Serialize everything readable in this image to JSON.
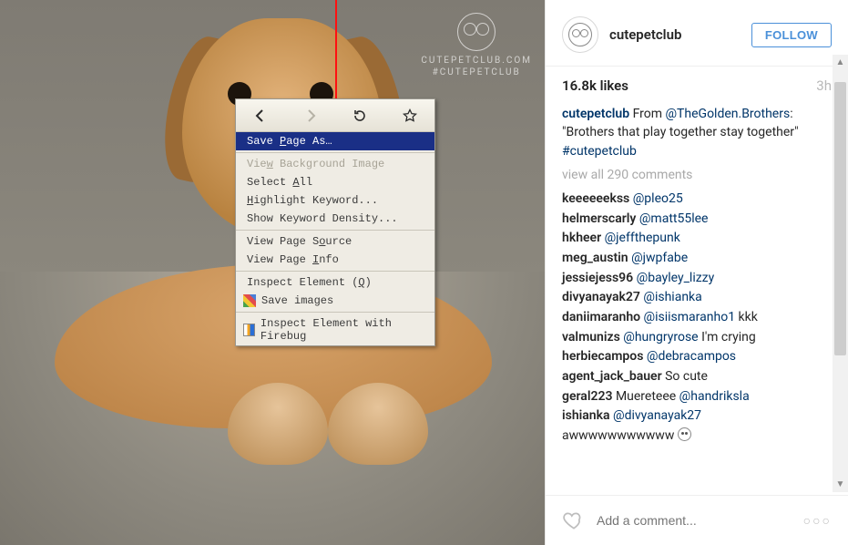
{
  "watermark": {
    "line1": "CUTEPETCLUB.COM",
    "line2": "#CUTEPETCLUB"
  },
  "context_menu": {
    "toolbar": {
      "back": "back-icon",
      "forward": "forward-icon",
      "reload": "reload-icon",
      "bookmark": "star-icon"
    },
    "items": [
      {
        "kind": "item",
        "label": "Save Page As…",
        "underline": "P",
        "selected": true
      },
      {
        "kind": "sep"
      },
      {
        "kind": "item",
        "label": "View Background Image",
        "underline": "w",
        "disabled": true
      },
      {
        "kind": "item",
        "label": "Select All",
        "underline": "A"
      },
      {
        "kind": "item",
        "label": "Highlight Keyword...",
        "underline": "H"
      },
      {
        "kind": "item",
        "label": "Show Keyword Density..."
      },
      {
        "kind": "sep"
      },
      {
        "kind": "item",
        "label": "View Page Source",
        "underline": "o"
      },
      {
        "kind": "item",
        "label": "View Page Info",
        "underline": "I"
      },
      {
        "kind": "sep"
      },
      {
        "kind": "item",
        "label": "Inspect Element (Q)",
        "underline": "Q"
      },
      {
        "kind": "item-icon",
        "icon": "sv",
        "label": "Save images"
      },
      {
        "kind": "sep"
      },
      {
        "kind": "item-icon",
        "icon": "fb",
        "label": "Inspect Element with Firebug"
      }
    ]
  },
  "post": {
    "username": "cutepetclub",
    "follow_label": "FOLLOW",
    "likes": "16.8k likes",
    "age": "3h",
    "caption_user": "cutepetclub",
    "caption_before": " From ",
    "caption_mention": "@TheGolden.Brothers",
    "caption_after": ": \"Brothers that play together stay together\" ",
    "caption_hashtag": "#cutepetclub",
    "view_all": "view all 290 comments",
    "add_comment_placeholder": "Add a comment...",
    "more": "○ ○ ○"
  },
  "comments": [
    {
      "user": "keeeeeekss",
      "tag": "@pleo25",
      "text": ""
    },
    {
      "user": "helmerscarly",
      "tag": "@matt55lee",
      "text": ""
    },
    {
      "user": "hkheer",
      "tag": "@jeffthepunk",
      "text": ""
    },
    {
      "user": "meg_austin",
      "tag": "@jwpfabe",
      "text": ""
    },
    {
      "user": "jessiejess96",
      "tag": "@bayley_lizzy",
      "text": ""
    },
    {
      "user": "divyanayak27",
      "tag": "@ishianka",
      "text": ""
    },
    {
      "user": "daniimaranho",
      "tag": "@isiismaranho1",
      "text": " kkk"
    },
    {
      "user": "valmunizs",
      "tag": "@hungryrose",
      "text": " I'm crying"
    },
    {
      "user": "herbiecampos",
      "tag": "@debracampos",
      "text": ""
    },
    {
      "user": "agent_jack_bauer",
      "tag": "",
      "text": " So cute"
    },
    {
      "user": "geral223",
      "tag": "@handriksla",
      "text_before": " Muereteee "
    },
    {
      "user": "ishianka",
      "tag": "@divyanayak27",
      "text": ""
    },
    {
      "user": "",
      "tag": "",
      "text": "awwwwwwwwwww ",
      "emoji": true
    }
  ]
}
